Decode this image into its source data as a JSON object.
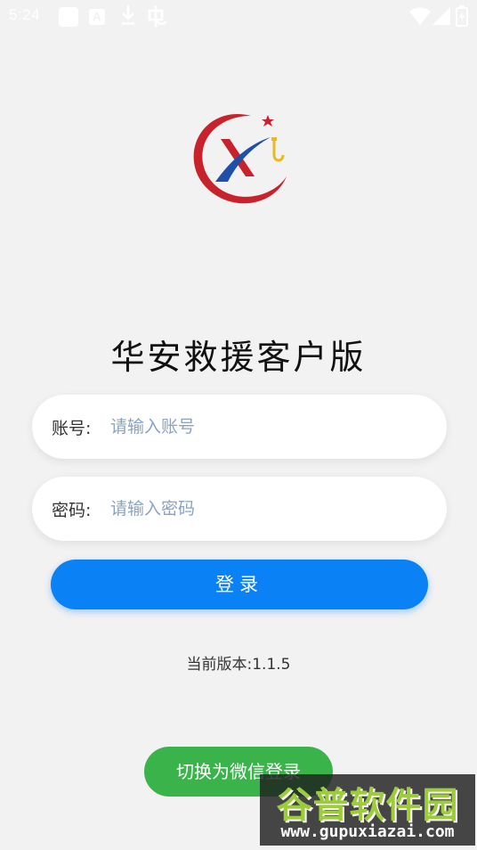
{
  "status_bar": {
    "time": "5:24",
    "icons": [
      "app-square-icon",
      "a-icon",
      "download-icon",
      "bug-icon",
      "wifi-icon",
      "signal-icon",
      "battery-icon"
    ]
  },
  "logo": {
    "icon": "company-logo-x-icon",
    "colors": {
      "red": "#c8232c",
      "blue": "#1f4fa6",
      "gold": "#e8b923"
    }
  },
  "app_title": "华安救援客户版",
  "form": {
    "account": {
      "label": "账号:",
      "placeholder": "请输入账号",
      "value": ""
    },
    "password": {
      "label": "密码:",
      "placeholder": "请输入密码",
      "value": ""
    }
  },
  "login_button": {
    "label": "登录",
    "color": "#0a82f5"
  },
  "version_text": "当前版本:1.1.5",
  "wechat_button": {
    "label": "切换为微信登录",
    "color": "#3ab44a"
  },
  "watermark": {
    "title": "谷普软件园",
    "url": "www.gupuxiazai.com"
  }
}
